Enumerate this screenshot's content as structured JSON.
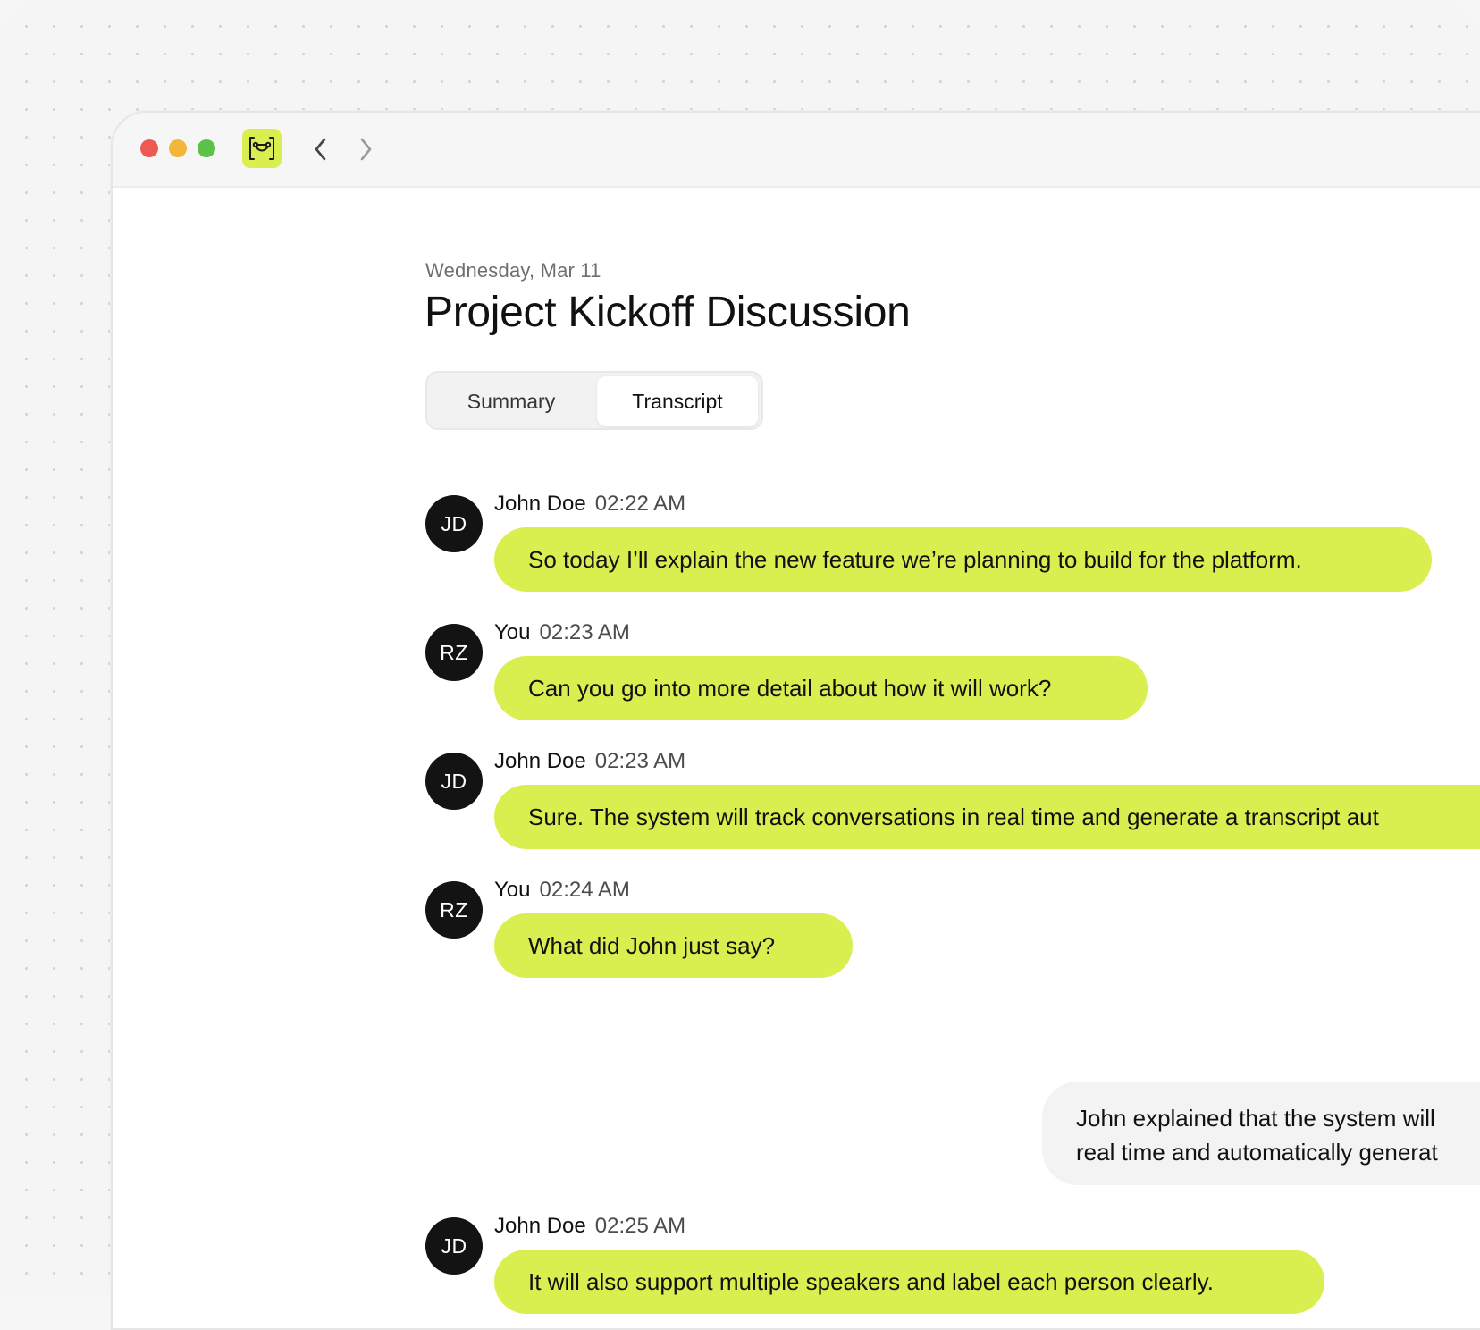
{
  "window": {
    "controls": [
      "close",
      "minimize",
      "maximize"
    ],
    "app_icon": "bracket-link-icon",
    "nav": {
      "back_icon": "chevron-left-icon",
      "forward_icon": "chevron-right-icon"
    }
  },
  "page": {
    "date": "Wednesday, Mar 11",
    "title": "Project Kickoff Discussion"
  },
  "tabs": [
    {
      "label": "Summary",
      "active": false
    },
    {
      "label": "Transcript",
      "active": true
    }
  ],
  "messages": [
    {
      "initials": "JD",
      "speaker": "John Doe",
      "time": "02:22 AM",
      "text": "So today I’ll explain the new feature we’re planning to build for the platform."
    },
    {
      "initials": "RZ",
      "speaker": "You",
      "time": "02:23 AM",
      "text": "Can you go into more detail about how it will work?"
    },
    {
      "initials": "JD",
      "speaker": "John Doe",
      "time": "02:23 AM",
      "text": "Sure. The system will track conversations in real time and generate a transcript aut"
    },
    {
      "initials": "RZ",
      "speaker": "You",
      "time": "02:24 AM",
      "text": "What did John just say?"
    },
    {
      "initials": "JD",
      "speaker": "John Doe",
      "time": "02:25 AM",
      "text": "It will also support multiple speakers and label each person clearly."
    }
  ],
  "assistant_reply": {
    "lines": [
      "John explained that the system will",
      "real time and automatically generat"
    ]
  },
  "colors": {
    "accent": "#d9ef4f",
    "avatar": "#131313",
    "close": "#ee5a52",
    "minimize": "#f3b53a",
    "maximize": "#5bc247"
  }
}
